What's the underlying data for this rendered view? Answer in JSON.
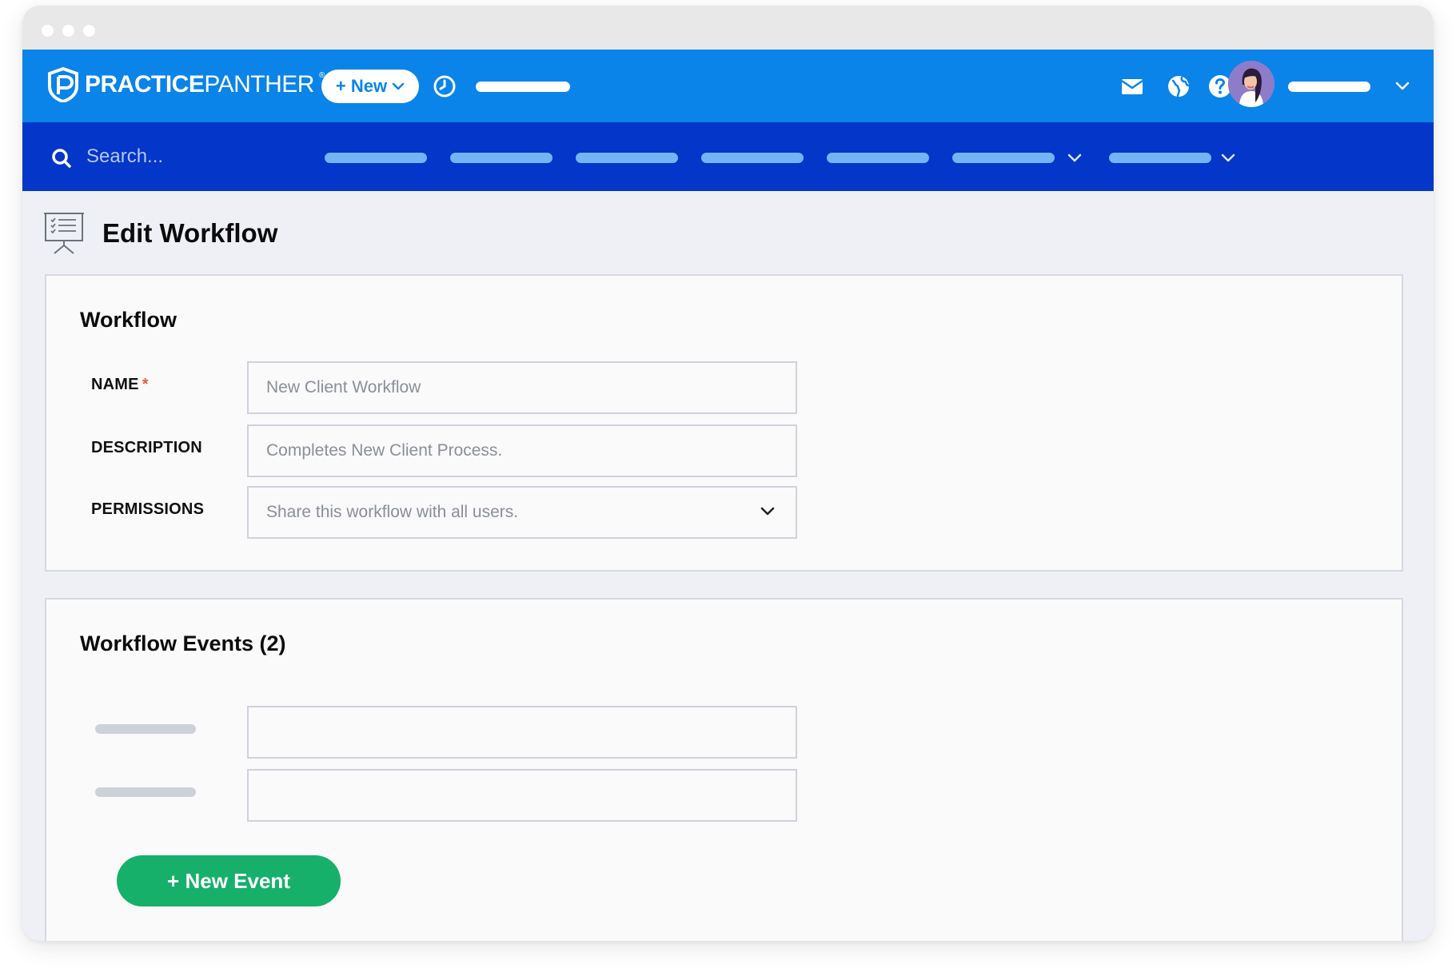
{
  "app": {
    "logo_bold": "PRACTICE",
    "logo_thin": "PANTHER",
    "logo_reg": "®"
  },
  "topbar": {
    "new_label": "+ New",
    "icons": [
      "clock-icon",
      "mail-icon",
      "globe-icon",
      "help-icon"
    ]
  },
  "navbar": {
    "search_placeholder": "Search..."
  },
  "page": {
    "title": "Edit Workflow"
  },
  "workflow_card": {
    "title": "Workflow",
    "name_label": "NAME",
    "name_required": "*",
    "name_value": "New Client Workflow",
    "description_label": "DESCRIPTION",
    "description_value": "Completes New Client Process.",
    "permissions_label": "PERMISSIONS",
    "permissions_value": "Share this workflow with all users."
  },
  "events_card": {
    "title": "Workflow Events (2)",
    "new_event_label": "+ New Event"
  },
  "colors": {
    "topbar": "#0a84e8",
    "navbar": "#0336c9",
    "nav_placeholder": "#74b4f5",
    "new_event": "#16b06b",
    "required": "#e8603c"
  }
}
